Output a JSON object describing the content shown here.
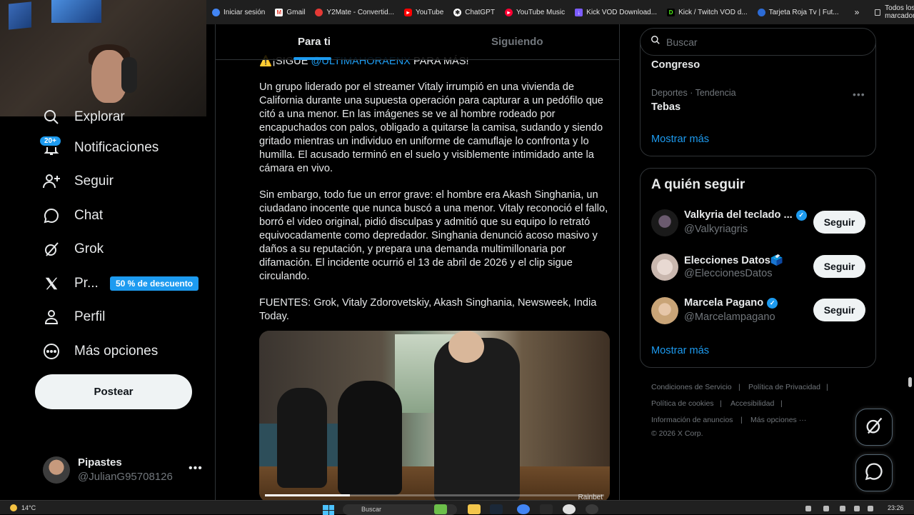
{
  "bookmarks": {
    "items": [
      {
        "label": "Iniciar sesión",
        "icon": "google-account-icon",
        "color": "#4285f4"
      },
      {
        "label": "Gmail",
        "icon": "gmail-icon",
        "color": "#ea4335"
      },
      {
        "label": "Y2Mate - Convertid...",
        "icon": "y2mate-icon",
        "color": "#e53935"
      },
      {
        "label": "YouTube",
        "icon": "youtube-icon",
        "color": "#ff0000"
      },
      {
        "label": "ChatGPT",
        "icon": "chatgpt-icon",
        "color": "#ffffff"
      },
      {
        "label": "YouTube Music",
        "icon": "youtube-music-icon",
        "color": "#ff0033"
      },
      {
        "label": "Kick VOD Download...",
        "icon": "kick-vod-icon",
        "color": "#7c5cff"
      },
      {
        "label": "Kick / Twitch VOD d...",
        "icon": "kick-icon",
        "color": "#53fc18"
      },
      {
        "label": "Tarjeta Roja Tv | Fut...",
        "icon": "tarjeta-roja-icon",
        "color": "#2c6bd6"
      }
    ],
    "more": "»",
    "all_bookmarks": "Todos los marcadores"
  },
  "nav": {
    "explore": "Explorar",
    "notifications": "Notificaciones",
    "notifications_badge": "20+",
    "follow": "Seguir",
    "chat": "Chat",
    "grok": "Grok",
    "premium": "Pr...",
    "premium_badge": "50 % de descuento",
    "profile": "Perfil",
    "more_options": "Más opciones",
    "post_button": "Postear"
  },
  "account": {
    "name": "Pipastes",
    "handle": "@JulianG95708126",
    "more": "•••"
  },
  "timeline": {
    "tab_for_you": "Para ti",
    "tab_following": "Siguiendo"
  },
  "post": {
    "cta_prefix": "⚠️¡SIGUE ",
    "cta_mention": "@ULTIMAHORAENX",
    "cta_suffix": " PARA MÁS!",
    "paragraph_1": "Un grupo liderado por el streamer Vitaly irrumpió en una vivienda de California durante una supuesta operación para capturar a un pedófilo que citó a una menor. En las imágenes se ve al hombre rodeado por encapuchados con palos, obligado a quitarse la camisa, sudando y siendo gritado mientras un individuo en uniforme de camuflaje lo confronta y lo humilla. El acusado terminó en el suelo y visiblemente intimidado ante la cámara en vivo.",
    "paragraph_2": "Sin embargo, todo fue un error grave: el hombre era Akash Singhania, un ciudadano inocente que nunca buscó a una menor. Vitaly reconoció el fallo, borró el video original, pidió disculpas y admitió que su equipo lo retrató equivocadamente como depredador. Singhania denunció acoso masivo y daños a su reputación, y prepara una demanda multimillonaria por difamación. El incidente ocurrió el 13 de abril de 2026 y el clip sigue circulando.",
    "sources": "FUENTES: Grok, Vitaly Zdorovetskiy, Akash Singhania, Newsweek, India Today.",
    "media_watermark": "Rainbet",
    "video_progress": 0.25
  },
  "search": {
    "placeholder": "Buscar"
  },
  "trends": {
    "top_partial": "Congreso",
    "meta": "Deportes · Tendencia",
    "name": "Tebas",
    "more_dots": "•••",
    "show_more": "Mostrar más"
  },
  "who_to_follow": {
    "title": "A quién seguir",
    "accounts": [
      {
        "name": "Valkyria del teclado ...",
        "handle": "@Valkyriagris",
        "verified": true,
        "follow": "Seguir"
      },
      {
        "name": "Elecciones Datos🗳️",
        "handle": "@EleccionesDatos",
        "verified": false,
        "follow": "Seguir"
      },
      {
        "name": "Marcela Pagano",
        "handle": "@Marcelampagano",
        "verified": true,
        "follow": "Seguir"
      }
    ],
    "show_more": "Mostrar más"
  },
  "footer": {
    "terms": "Condiciones de Servicio",
    "privacy": "Política de Privacidad",
    "cookies": "Política de cookies",
    "accessibility": "Accesibilidad",
    "ads": "Información de anuncios",
    "more": "Más opciones ···",
    "copyright": "© 2026 X Corp.",
    "sep": "|"
  },
  "taskbar": {
    "weather": "14°C",
    "search": "Buscar",
    "time": "23:26"
  },
  "colors": {
    "accent": "#1d9bf0",
    "background": "#000000",
    "border": "#2f3336",
    "muted_text": "#71767b"
  }
}
